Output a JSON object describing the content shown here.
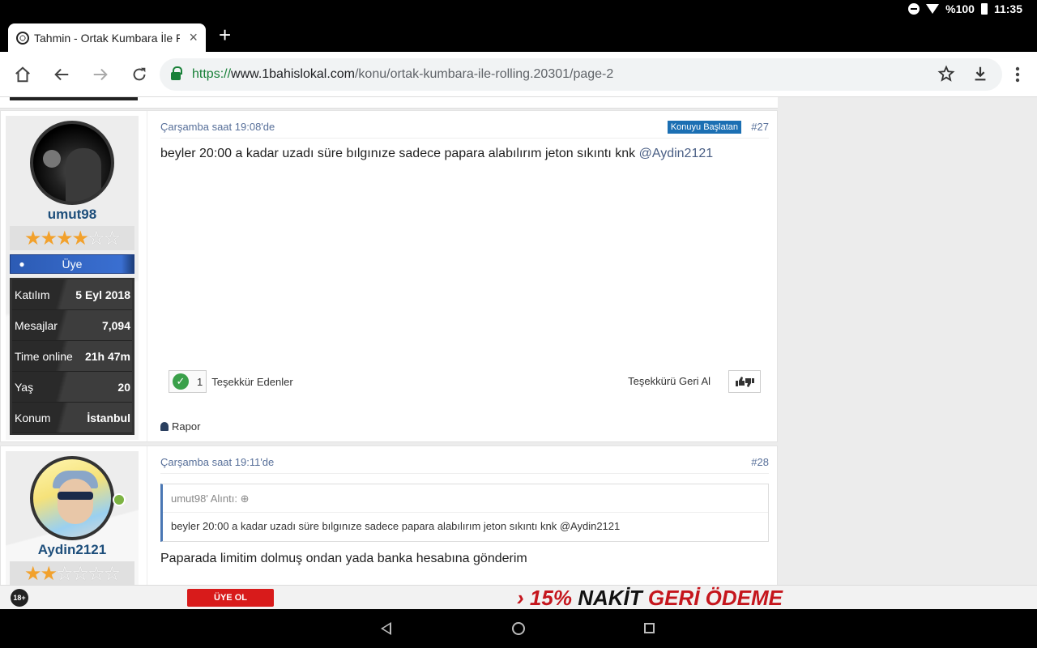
{
  "status_bar": {
    "battery": "%100",
    "time": "11:35"
  },
  "browser": {
    "tab_title": "Tahmin - Ortak Kumbara İle Rolling",
    "tab_close": "×",
    "new_tab": "+",
    "url_scheme": "https://",
    "url_host": "www.1bahislokal.com",
    "url_path": "/konu/ortak-kumbara-ile-rolling.20301/page-2",
    "icons": {
      "home": "home-icon",
      "back": "back-arrow-icon",
      "forward": "forward-arrow-icon",
      "reload": "reload-icon",
      "star": "bookmark-star-icon",
      "download": "download-icon",
      "menu": "more-vert-icon"
    }
  },
  "posts": [
    {
      "user": {
        "username": "umut98",
        "stars_on": "★★★★",
        "stars_off": "☆☆",
        "rank": "Üye",
        "stats": [
          {
            "label": "Katılım",
            "value": "5 Eyl 2018"
          },
          {
            "label": "Mesajlar",
            "value": "7,094"
          },
          {
            "label": "Time online",
            "value": "21h 47m"
          },
          {
            "label": "Yaş",
            "value": "20"
          },
          {
            "label": "Konum",
            "value": "İstanbul"
          }
        ]
      },
      "date": "Çarşamba saat 19:08'de",
      "badge": "Konuyu Başlatan",
      "number": "#27",
      "text": "beyler 20:00 a kadar uzadı süre bılgınıze sadece papara alabılırım jeton sıkıntı knk",
      "mention": "@Aydin2121",
      "thanks_count": "1",
      "thanks_label": "Teşekkür Edenler",
      "unthank_label": "Teşekkürü Geri Al",
      "report_label": "Rapor"
    },
    {
      "user": {
        "username": "Aydin2121",
        "stars_on": "★★",
        "stars_off": "☆☆☆☆"
      },
      "date": "Çarşamba saat 19:11'de",
      "number": "#28",
      "quote_head": "umut98' Alıntı:",
      "quote_text": "beyler 20:00 a kadar uzadı süre bılgınıze sadece papara alabılırım jeton sıkıntı knk @Aydin2121",
      "text": "Paparada limitim dolmuş ondan yada banka hesabına gönderim"
    }
  ],
  "ad": {
    "age": "18+",
    "signup": "ÜYE OL",
    "promo_arrow": "›",
    "promo_pct": "15%",
    "promo_word1": "NAKİT",
    "promo_word2": "GERİ ÖDEME"
  }
}
